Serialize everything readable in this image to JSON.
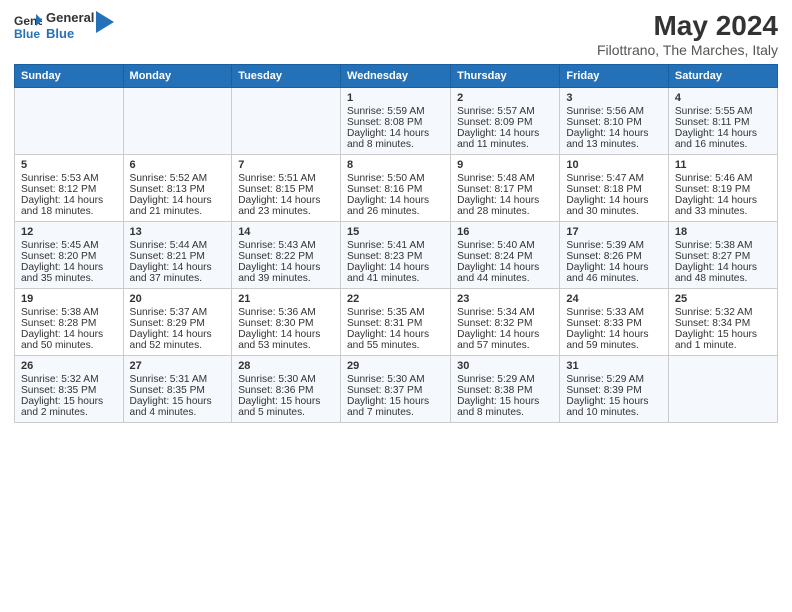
{
  "header": {
    "logo_line1": "General",
    "logo_line2": "Blue",
    "main_title": "May 2024",
    "subtitle": "Filottrano, The Marches, Italy"
  },
  "columns": [
    "Sunday",
    "Monday",
    "Tuesday",
    "Wednesday",
    "Thursday",
    "Friday",
    "Saturday"
  ],
  "weeks": [
    [
      {
        "day": "",
        "text": ""
      },
      {
        "day": "",
        "text": ""
      },
      {
        "day": "",
        "text": ""
      },
      {
        "day": "1",
        "text": "Sunrise: 5:59 AM\nSunset: 8:08 PM\nDaylight: 14 hours and 8 minutes."
      },
      {
        "day": "2",
        "text": "Sunrise: 5:57 AM\nSunset: 8:09 PM\nDaylight: 14 hours and 11 minutes."
      },
      {
        "day": "3",
        "text": "Sunrise: 5:56 AM\nSunset: 8:10 PM\nDaylight: 14 hours and 13 minutes."
      },
      {
        "day": "4",
        "text": "Sunrise: 5:55 AM\nSunset: 8:11 PM\nDaylight: 14 hours and 16 minutes."
      }
    ],
    [
      {
        "day": "5",
        "text": "Sunrise: 5:53 AM\nSunset: 8:12 PM\nDaylight: 14 hours and 18 minutes."
      },
      {
        "day": "6",
        "text": "Sunrise: 5:52 AM\nSunset: 8:13 PM\nDaylight: 14 hours and 21 minutes."
      },
      {
        "day": "7",
        "text": "Sunrise: 5:51 AM\nSunset: 8:15 PM\nDaylight: 14 hours and 23 minutes."
      },
      {
        "day": "8",
        "text": "Sunrise: 5:50 AM\nSunset: 8:16 PM\nDaylight: 14 hours and 26 minutes."
      },
      {
        "day": "9",
        "text": "Sunrise: 5:48 AM\nSunset: 8:17 PM\nDaylight: 14 hours and 28 minutes."
      },
      {
        "day": "10",
        "text": "Sunrise: 5:47 AM\nSunset: 8:18 PM\nDaylight: 14 hours and 30 minutes."
      },
      {
        "day": "11",
        "text": "Sunrise: 5:46 AM\nSunset: 8:19 PM\nDaylight: 14 hours and 33 minutes."
      }
    ],
    [
      {
        "day": "12",
        "text": "Sunrise: 5:45 AM\nSunset: 8:20 PM\nDaylight: 14 hours and 35 minutes."
      },
      {
        "day": "13",
        "text": "Sunrise: 5:44 AM\nSunset: 8:21 PM\nDaylight: 14 hours and 37 minutes."
      },
      {
        "day": "14",
        "text": "Sunrise: 5:43 AM\nSunset: 8:22 PM\nDaylight: 14 hours and 39 minutes."
      },
      {
        "day": "15",
        "text": "Sunrise: 5:41 AM\nSunset: 8:23 PM\nDaylight: 14 hours and 41 minutes."
      },
      {
        "day": "16",
        "text": "Sunrise: 5:40 AM\nSunset: 8:24 PM\nDaylight: 14 hours and 44 minutes."
      },
      {
        "day": "17",
        "text": "Sunrise: 5:39 AM\nSunset: 8:26 PM\nDaylight: 14 hours and 46 minutes."
      },
      {
        "day": "18",
        "text": "Sunrise: 5:38 AM\nSunset: 8:27 PM\nDaylight: 14 hours and 48 minutes."
      }
    ],
    [
      {
        "day": "19",
        "text": "Sunrise: 5:38 AM\nSunset: 8:28 PM\nDaylight: 14 hours and 50 minutes."
      },
      {
        "day": "20",
        "text": "Sunrise: 5:37 AM\nSunset: 8:29 PM\nDaylight: 14 hours and 52 minutes."
      },
      {
        "day": "21",
        "text": "Sunrise: 5:36 AM\nSunset: 8:30 PM\nDaylight: 14 hours and 53 minutes."
      },
      {
        "day": "22",
        "text": "Sunrise: 5:35 AM\nSunset: 8:31 PM\nDaylight: 14 hours and 55 minutes."
      },
      {
        "day": "23",
        "text": "Sunrise: 5:34 AM\nSunset: 8:32 PM\nDaylight: 14 hours and 57 minutes."
      },
      {
        "day": "24",
        "text": "Sunrise: 5:33 AM\nSunset: 8:33 PM\nDaylight: 14 hours and 59 minutes."
      },
      {
        "day": "25",
        "text": "Sunrise: 5:32 AM\nSunset: 8:34 PM\nDaylight: 15 hours and 1 minute."
      }
    ],
    [
      {
        "day": "26",
        "text": "Sunrise: 5:32 AM\nSunset: 8:35 PM\nDaylight: 15 hours and 2 minutes."
      },
      {
        "day": "27",
        "text": "Sunrise: 5:31 AM\nSunset: 8:35 PM\nDaylight: 15 hours and 4 minutes."
      },
      {
        "day": "28",
        "text": "Sunrise: 5:30 AM\nSunset: 8:36 PM\nDaylight: 15 hours and 5 minutes."
      },
      {
        "day": "29",
        "text": "Sunrise: 5:30 AM\nSunset: 8:37 PM\nDaylight: 15 hours and 7 minutes."
      },
      {
        "day": "30",
        "text": "Sunrise: 5:29 AM\nSunset: 8:38 PM\nDaylight: 15 hours and 8 minutes."
      },
      {
        "day": "31",
        "text": "Sunrise: 5:29 AM\nSunset: 8:39 PM\nDaylight: 15 hours and 10 minutes."
      },
      {
        "day": "",
        "text": ""
      }
    ]
  ]
}
